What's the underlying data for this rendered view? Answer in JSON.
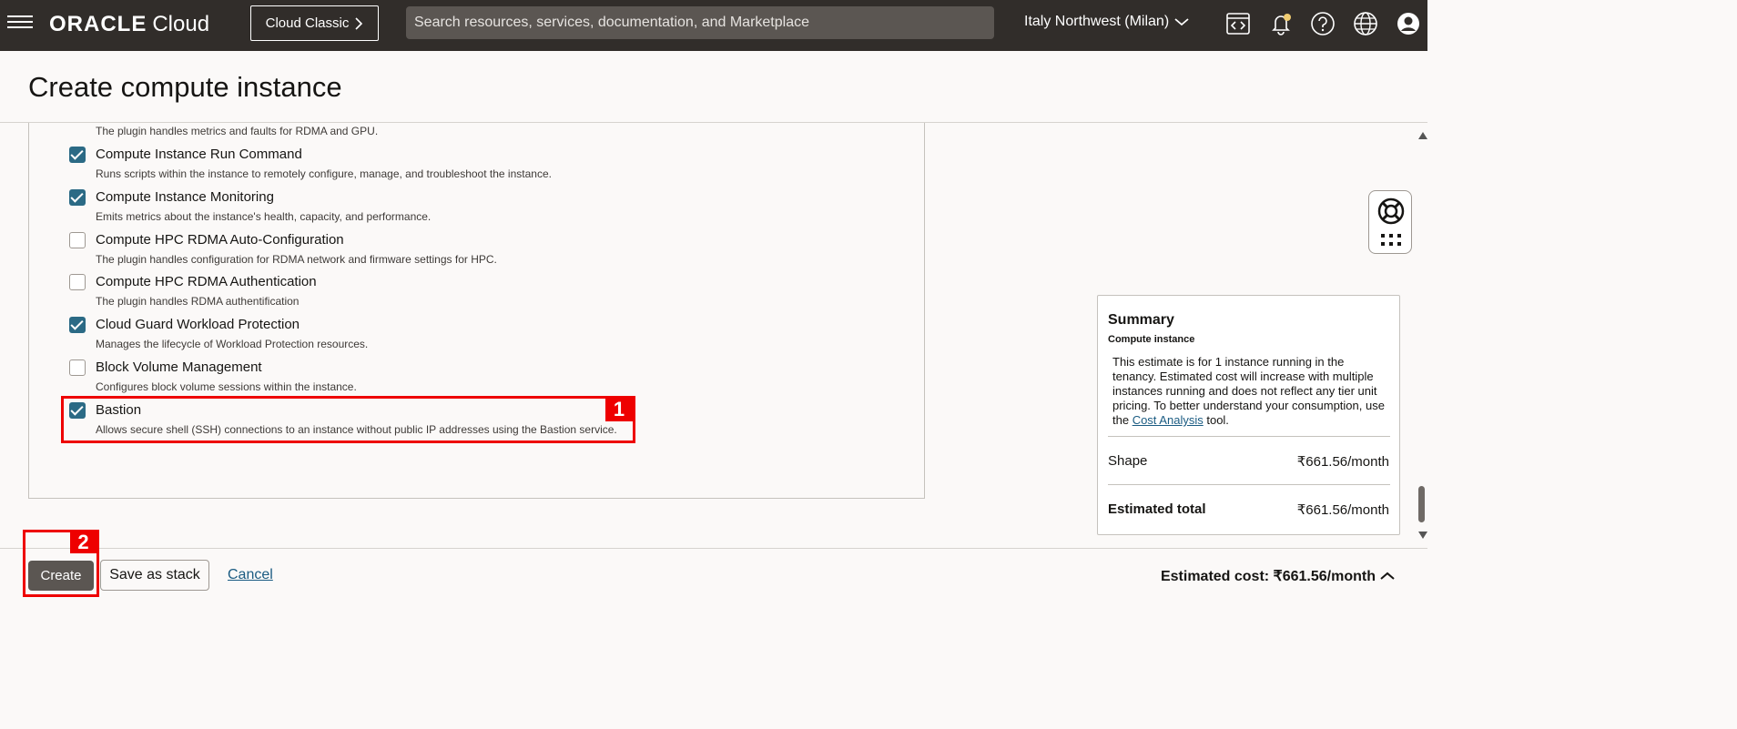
{
  "header": {
    "brand": "ORACLE",
    "product": "Cloud",
    "classic_button": "Cloud Classic",
    "search_placeholder": "Search resources, services, documentation, and Marketplace",
    "region": "Italy Northwest (Milan)"
  },
  "page": {
    "title": "Create compute instance"
  },
  "plugins": {
    "top_partial_description": "The plugin handles metrics and faults for RDMA and GPU.",
    "items": [
      {
        "name": "Compute Instance Run Command",
        "description": "Runs scripts within the instance to remotely configure, manage, and troubleshoot the instance.",
        "checked": true
      },
      {
        "name": "Compute Instance Monitoring",
        "description": "Emits metrics about the instance's health, capacity, and performance.",
        "checked": true
      },
      {
        "name": "Compute HPC RDMA Auto-Configuration",
        "description": "The plugin handles configuration for RDMA network and firmware settings for HPC.",
        "checked": false
      },
      {
        "name": "Compute HPC RDMA Authentication",
        "description": "The plugin handles RDMA authentification",
        "checked": false
      },
      {
        "name": "Cloud Guard Workload Protection",
        "description": "Manages the lifecycle of Workload Protection resources.",
        "checked": true
      },
      {
        "name": "Block Volume Management",
        "description": "Configures block volume sessions within the instance.",
        "checked": false
      },
      {
        "name": "Bastion",
        "description": "Allows secure shell (SSH) connections to an instance without public IP addresses using the Bastion service.",
        "checked": true
      }
    ]
  },
  "annotations": {
    "step1": "1",
    "step2": "2"
  },
  "summary": {
    "title": "Summary",
    "subtitle": "Compute instance",
    "text_before_link": "This estimate is for 1 instance running in the tenancy. Estimated cost will increase with multiple instances running and does not reflect any tier unit pricing. To better understand your consumption, use the ",
    "link": "Cost Analysis",
    "text_after_link": " tool.",
    "shape_label": "Shape",
    "shape_value": "₹661.56/month",
    "total_label": "Estimated total",
    "total_value": "₹661.56/month"
  },
  "footer": {
    "create": "Create",
    "save_stack": "Save as stack",
    "cancel": "Cancel",
    "estimated_cost": "Estimated cost: ₹661.56/month"
  },
  "colors": {
    "topbar": "#312d2a",
    "checkbox_on": "#2b6a85",
    "highlight": "#ee0000",
    "link": "#1a5b82"
  }
}
